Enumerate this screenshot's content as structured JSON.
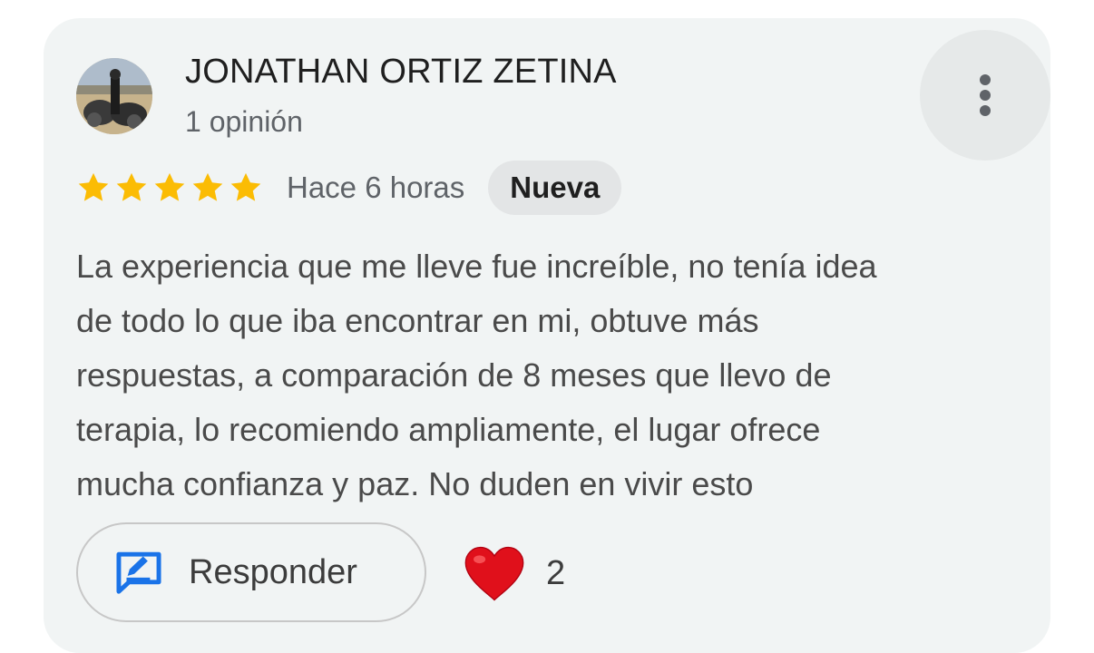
{
  "review": {
    "author": {
      "name": "JONATHAN ORTIZ ZETINA",
      "meta": "1 opinión"
    },
    "rating": 5,
    "time": "Hace 6 horas",
    "badge": "Nueva",
    "lines": [
      "La experiencia que me lleve fue increíble, no tenía idea",
      "de todo lo que iba encontrar en mi, obtuve más",
      "respuestas, a comparación de 8 meses que llevo de",
      "terapia, lo recomiendo ampliamente, el lugar ofrece",
      "mucha confianza y paz. No duden en vivir esto"
    ],
    "reply_label": "Responder",
    "reaction_count": "2"
  },
  "icons": {
    "more": "more-vert-icon",
    "star": "star-icon",
    "reply": "reply-edit-icon",
    "heart": "heart-icon"
  },
  "colors": {
    "star": "#fbbc04",
    "reply_icon": "#1a73e8",
    "heart": "#e0101b",
    "card_bg": "#f1f4f4"
  }
}
